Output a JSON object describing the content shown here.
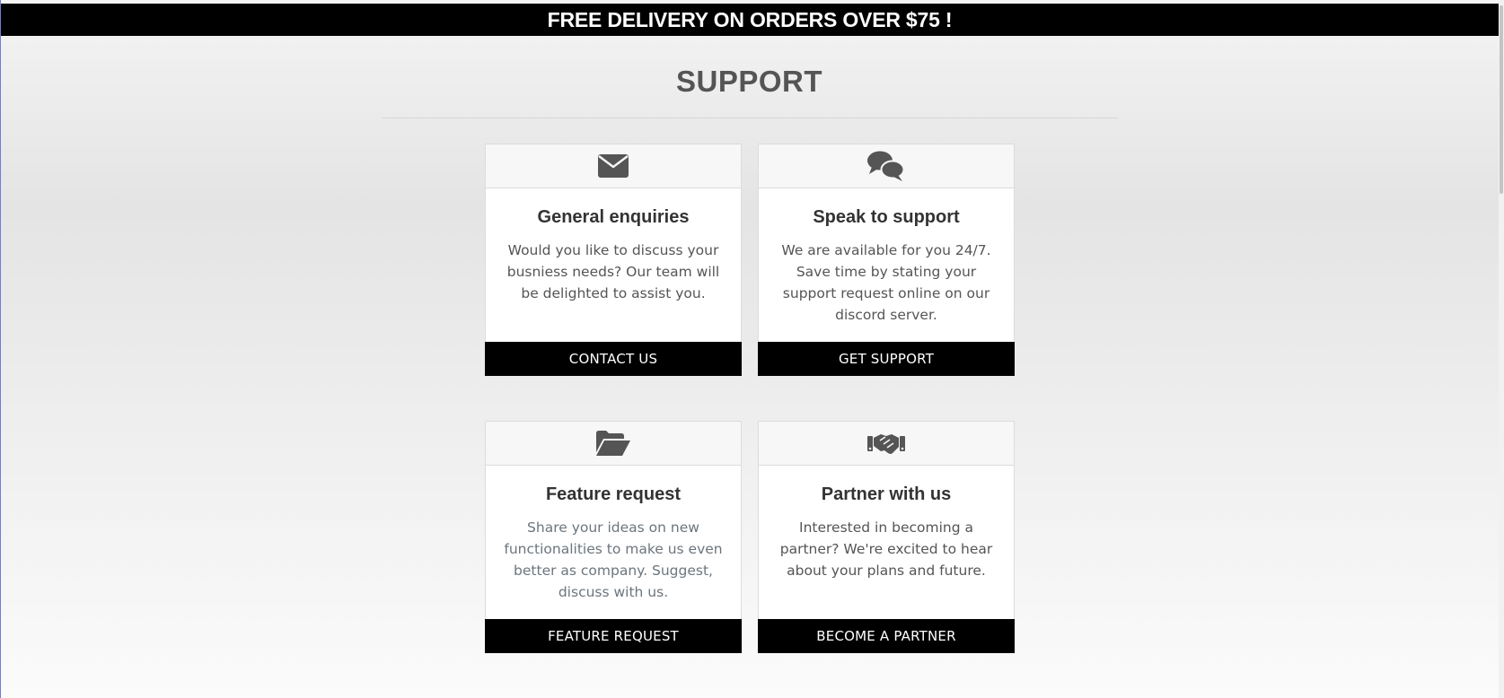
{
  "banner": {
    "text": "FREE DELIVERY ON ORDERS OVER $75 !"
  },
  "page": {
    "title": "SUPPORT"
  },
  "cards": [
    {
      "icon": "envelope-icon",
      "title": "General enquiries",
      "text": "Would you like to discuss your busniess needs? Our team will be delighted to assist you.",
      "button": "CONTACT US"
    },
    {
      "icon": "chat-bubbles-icon",
      "title": "Speak to support",
      "text": "We are available for you 24/7. Save time by stating your support request online on our discord server.",
      "button": "GET SUPPORT"
    },
    {
      "icon": "folder-open-icon",
      "title": "Feature request",
      "text": "Share your ideas on new functionalities to make us even better as company. Suggest, discuss with us.",
      "button": "FEATURE REQUEST"
    },
    {
      "icon": "handshake-icon",
      "title": "Partner with us",
      "text": "Interested in becoming a partner? We're excited to hear about your plans and future.",
      "button": "BECOME A PARTNER"
    }
  ],
  "colors": {
    "banner_bg": "#000000",
    "button_bg": "#000000",
    "icon": "#555555",
    "title_text": "#555555"
  }
}
